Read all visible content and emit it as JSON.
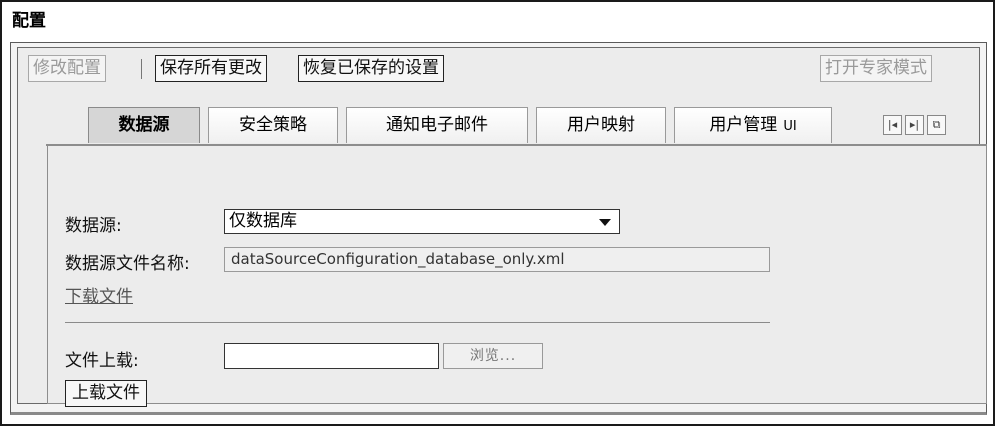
{
  "page": {
    "title": "配置"
  },
  "toolbar": {
    "edit_label": "修改配置",
    "save_all_label": "保存所有更改",
    "restore_label": "恢复已保存的设置",
    "expert_label": "打开专家模式"
  },
  "tabs": [
    {
      "label": "数据源",
      "suffix": "",
      "active": true
    },
    {
      "label": "安全策略",
      "suffix": "",
      "active": false
    },
    {
      "label": "通知电子邮件",
      "suffix": "",
      "active": false
    },
    {
      "label": "用户映射",
      "suffix": "",
      "active": false
    },
    {
      "label": "用户管理",
      "suffix": "UI",
      "active": false
    }
  ],
  "tab_nav": {
    "first_icon": "skip-to-first-icon",
    "last_icon": "skip-to-last-icon",
    "list_icon": "tab-list-icon",
    "first_glyph": "|◂",
    "last_glyph": "▸|",
    "list_glyph": "⧉"
  },
  "form": {
    "datasource_label": "数据源:",
    "datasource_value": "仅数据库",
    "filename_label": "数据源文件名称:",
    "filename_value": "dataSourceConfiguration_database_only.xml",
    "download_link": "下载文件",
    "upload_label": "文件上载:",
    "upload_value": "",
    "browse_label": "浏览...",
    "upload_button": "上载文件"
  }
}
